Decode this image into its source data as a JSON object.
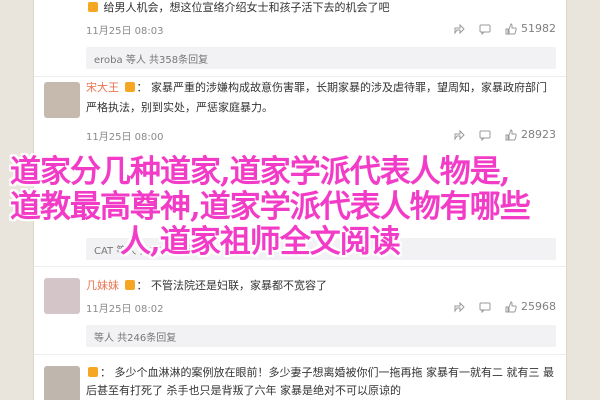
{
  "comments": [
    {
      "user": "",
      "text": "给男人机会，想这位宣络介绍女士和孩子活下去的机会了吧",
      "date": "11月25日 08:03",
      "replies": "",
      "likes": "51982",
      "reply_preview": ""
    },
    {
      "user": "",
      "text": "",
      "date": "",
      "replies": "",
      "likes": "",
      "reply_preview": "eroba 等人 共358条回复"
    },
    {
      "user": "宋大王",
      "text": "家暴严重的涉嫌构成故意伤害罪，长期家暴的涉及虐待罪，望周知，家暴政府部门严格执法，别到实处，严惩家庭暴力。",
      "date": "11月25日 08:00",
      "replies": "",
      "likes": "28923",
      "reply_preview": ""
    },
    {
      "user": "",
      "text": "",
      "date": "",
      "replies": "",
      "likes": "",
      "reply_preview": "CAT 等人 共1000条回复"
    },
    {
      "user": "几妹妹",
      "text": "不管法院还是妇联，家暴都不宽容了",
      "date": "11月25日 08:02",
      "replies": "",
      "likes": "25968",
      "reply_preview": ""
    },
    {
      "user": "",
      "text": "",
      "date": "",
      "replies": "",
      "likes": "",
      "reply_preview": "等人 共246条回复"
    },
    {
      "user": "",
      "text": "多少个血淋淋的案例放在眼前！多少妻子想离婚被你们一拖再拖 家暴有一就有二 就有三 最后甚至有打死了 杀手也只是背叛了六年 家暴是绝对不可以原谅的",
      "date": "",
      "replies": "",
      "likes": "",
      "reply_preview": ""
    }
  ],
  "overlay_title": [
    "道家分几种道家,道家学派代表人物是,",
    "道教最高尊神,道家学派代表人物有哪些",
    "人,道家祖师全文阅读"
  ],
  "colors": {
    "accent": "#eb7350",
    "overlay": "#f23cc7",
    "page_bg": "#e9e4dc"
  },
  "icons": [
    "share-icon",
    "comment-icon",
    "like-icon"
  ]
}
